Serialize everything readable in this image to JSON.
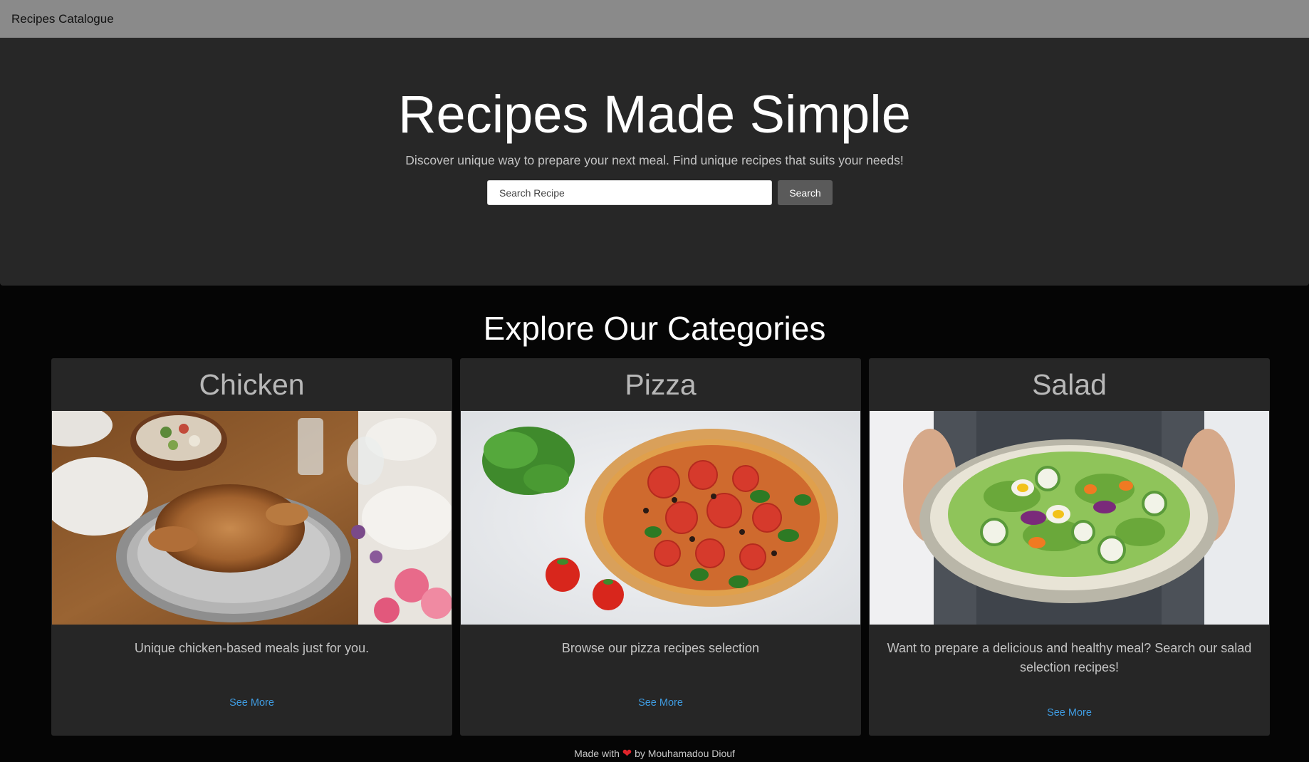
{
  "navbar": {
    "brand": "Recipes Catalogue"
  },
  "hero": {
    "title": "Recipes Made Simple",
    "subtitle": "Discover unique way to prepare your next meal. Find unique recipes that suits your needs!",
    "search_placeholder": "Search Recipe",
    "search_value": "",
    "search_button": "Search"
  },
  "categories": {
    "title": "Explore Our Categories",
    "items": [
      {
        "name": "Chicken",
        "description": "Unique chicken-based meals just for you.",
        "link": "See More",
        "image": "roast-chicken-photo"
      },
      {
        "name": "Pizza",
        "description": "Browse our pizza recipes selection",
        "link": "See More",
        "image": "pizza-photo"
      },
      {
        "name": "Salad",
        "description": "Want to prepare a delicious and healthy meal? Search our salad selection recipes!",
        "link": "See More",
        "image": "salad-photo"
      }
    ]
  },
  "footer": {
    "prefix": "Made with",
    "heart": "❤",
    "suffix": "by Mouhamadou Diouf"
  },
  "colors": {
    "accent_link": "#3f9be0",
    "navbar": "#8a8a8a",
    "hero_bg": "#272727",
    "card_bg": "#262626",
    "heart": "#e0242b"
  }
}
